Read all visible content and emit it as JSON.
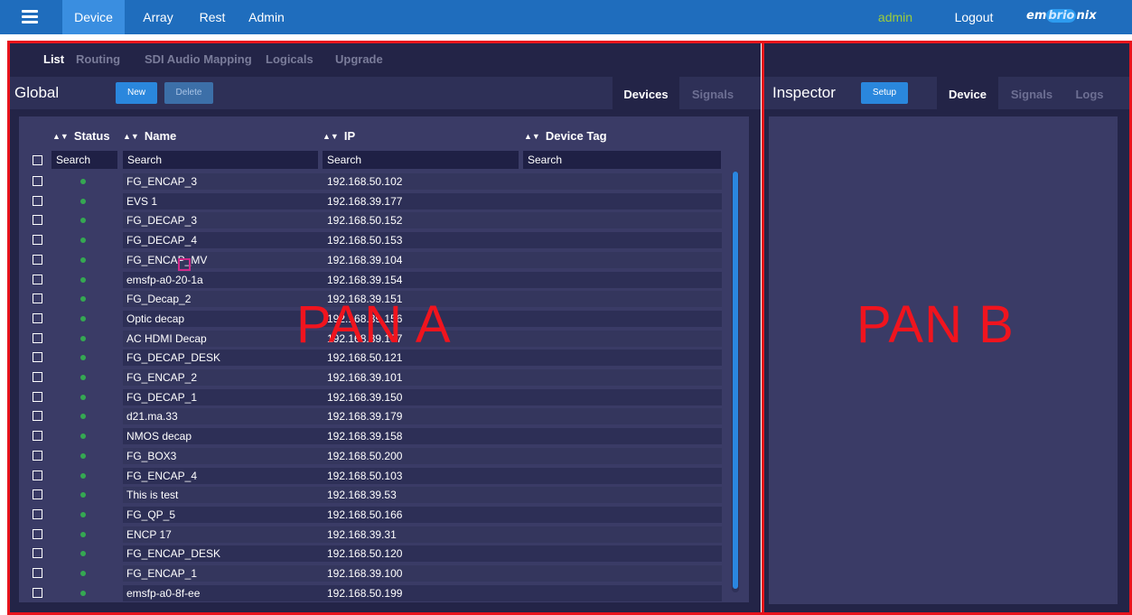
{
  "topnav": {
    "items": [
      {
        "label": "Device",
        "active": true
      },
      {
        "label": "Array",
        "active": false
      },
      {
        "label": "Rest",
        "active": false
      },
      {
        "label": "Admin",
        "active": false
      }
    ],
    "user": "admin",
    "logout": "Logout",
    "logo_text": "embrionix",
    "icons": {
      "menu": "hamburger-icon"
    }
  },
  "pan_a": {
    "label": "PAN A",
    "subtabs": [
      {
        "label": "List",
        "active": true
      },
      {
        "label": "Routing",
        "active": false
      },
      {
        "label": "SDI Audio Mapping",
        "active": false
      },
      {
        "label": "Logicals",
        "active": false
      },
      {
        "label": "Upgrade",
        "active": false
      }
    ],
    "title": "Global",
    "buttons": {
      "new": "New",
      "delete": "Delete"
    },
    "tabs": [
      {
        "label": "Devices",
        "active": true
      },
      {
        "label": "Signals",
        "active": false
      }
    ],
    "table": {
      "columns": [
        "Status",
        "Name",
        "IP",
        "Device Tag"
      ],
      "filters": {
        "status": "Search",
        "name": "Search",
        "ip": "Search",
        "device_tag": "Search"
      },
      "rows": [
        {
          "name": "FG_ENCAP_3",
          "ip": "192.168.50.102",
          "tag": ""
        },
        {
          "name": "EVS 1",
          "ip": "192.168.39.177",
          "tag": ""
        },
        {
          "name": "FG_DECAP_3",
          "ip": "192.168.50.152",
          "tag": ""
        },
        {
          "name": "FG_DECAP_4",
          "ip": "192.168.50.153",
          "tag": ""
        },
        {
          "name": "FG_ENCAP_MV",
          "ip": "192.168.39.104",
          "tag": ""
        },
        {
          "name": "emsfp-a0-20-1a",
          "ip": "192.168.39.154",
          "tag": ""
        },
        {
          "name": "FG_Decap_2",
          "ip": "192.168.39.151",
          "tag": ""
        },
        {
          "name": "Optic decap",
          "ip": "192.168.39.156",
          "tag": ""
        },
        {
          "name": "AC HDMI Decap",
          "ip": "192.168.39.157",
          "tag": ""
        },
        {
          "name": "FG_DECAP_DESK",
          "ip": "192.168.50.121",
          "tag": ""
        },
        {
          "name": "FG_ENCAP_2",
          "ip": "192.168.39.101",
          "tag": ""
        },
        {
          "name": "FG_DECAP_1",
          "ip": "192.168.39.150",
          "tag": ""
        },
        {
          "name": "d21.ma.33",
          "ip": "192.168.39.179",
          "tag": ""
        },
        {
          "name": "NMOS decap",
          "ip": "192.168.39.158",
          "tag": ""
        },
        {
          "name": "FG_BOX3",
          "ip": "192.168.50.200",
          "tag": ""
        },
        {
          "name": "FG_ENCAP_4",
          "ip": "192.168.50.103",
          "tag": ""
        },
        {
          "name": "This is test",
          "ip": "192.168.39.53",
          "tag": ""
        },
        {
          "name": "FG_QP_5",
          "ip": "192.168.50.166",
          "tag": ""
        },
        {
          "name": "ENCP 17",
          "ip": "192.168.39.31",
          "tag": ""
        },
        {
          "name": "FG_ENCAP_DESK",
          "ip": "192.168.50.120",
          "tag": ""
        },
        {
          "name": "FG_ENCAP_1",
          "ip": "192.168.39.100",
          "tag": ""
        },
        {
          "name": "emsfp-a0-8f-ee",
          "ip": "192.168.50.199",
          "tag": ""
        }
      ],
      "status_color": "#35a852"
    }
  },
  "pan_b": {
    "label": "PAN B",
    "title": "Inspector",
    "buttons": {
      "setup": "Setup"
    },
    "tabs": [
      {
        "label": "Device",
        "active": true
      },
      {
        "label": "Signals",
        "active": false
      },
      {
        "label": "Logs",
        "active": false
      }
    ]
  },
  "colors": {
    "frame": "#e8141c",
    "topbar": "#1f6dbd",
    "panel": "#3a3b66",
    "accent": "#2a87dd"
  }
}
